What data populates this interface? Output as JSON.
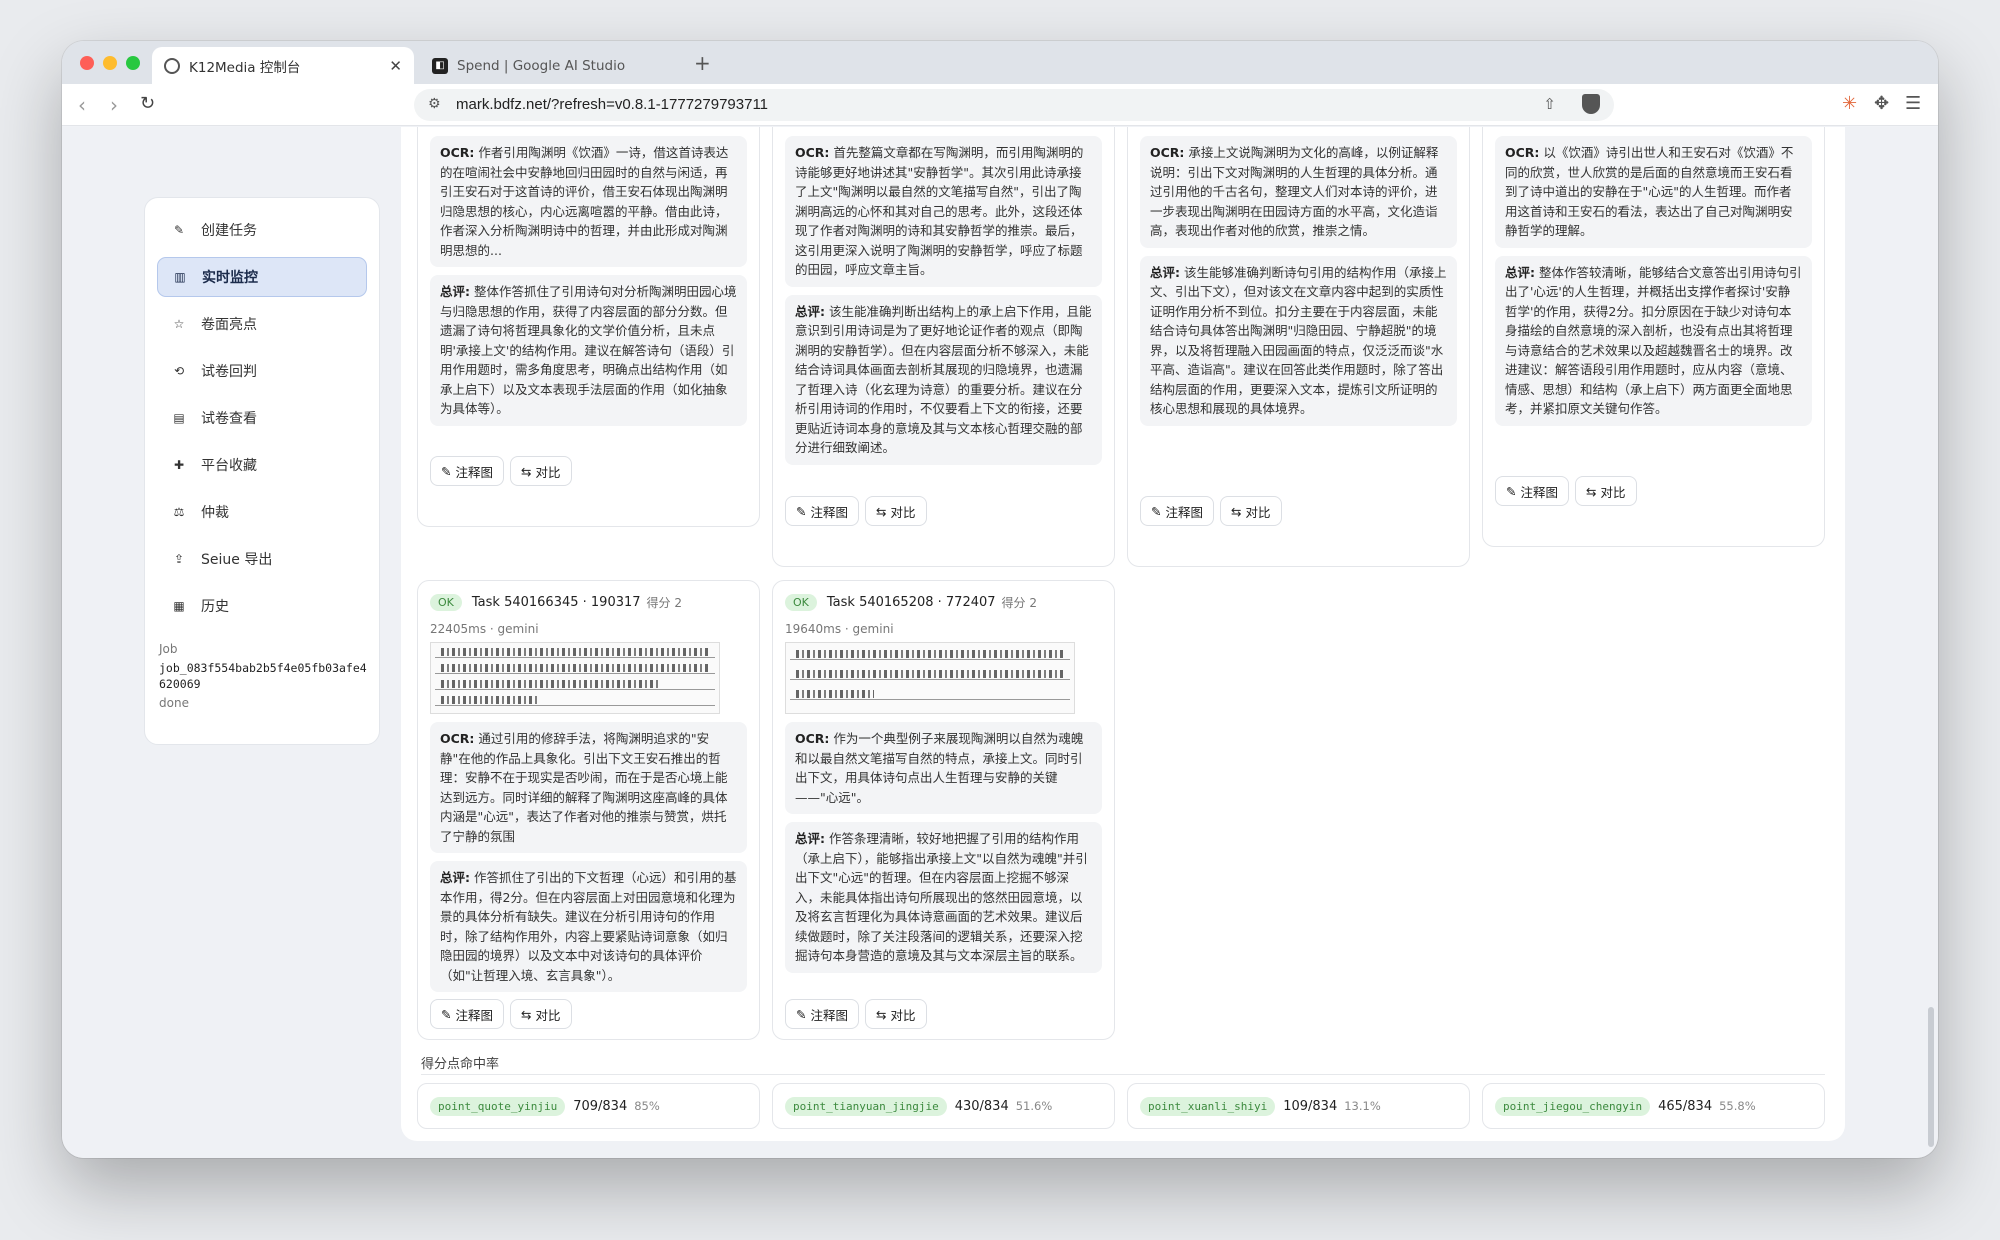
{
  "browser": {
    "tabs": [
      {
        "title": "K12Media 控制台",
        "close": "✕"
      },
      {
        "title": "Spend | Google AI Studio"
      }
    ],
    "new_tab": "+",
    "url": "mark.bdfz.net/?refresh=v0.8.1-1777279793711",
    "nav": {
      "back": "‹",
      "forward": "›",
      "reload": "↻"
    }
  },
  "sidebar": {
    "items": [
      {
        "label": "创建任务",
        "icon": "✎"
      },
      {
        "label": "实时监控",
        "icon": "▥",
        "active": true
      },
      {
        "label": "卷面亮点",
        "icon": "☆"
      },
      {
        "label": "试卷回判",
        "icon": "⟲"
      },
      {
        "label": "试卷查看",
        "icon": "▤"
      },
      {
        "label": "平台收藏",
        "icon": "✚"
      },
      {
        "label": "仲裁",
        "icon": "⚖"
      },
      {
        "label": "Seiue 导出",
        "icon": "⇪"
      },
      {
        "label": "历史",
        "icon": "▦"
      }
    ],
    "job": {
      "label": "Job",
      "id": "job_083f554bab2b5f4e05fb03afe4620069",
      "status": "done"
    }
  },
  "buttons": {
    "annotate": "注释图",
    "compare": "对比"
  },
  "cards_top": [
    {
      "ocr_label": "OCR:",
      "ocr": "作者引用陶渊明《饮酒》一诗，借这首诗表达的在喧闹社会中安静地回归田园时的自然与闲适，再引王安石对于这首诗的评价，借王安石体现出陶渊明归隐思想的核心，内心远离喧嚣的平静。借由此诗，作者深入分析陶渊明诗中的哲理，并由此形成对陶渊明思想的...",
      "comment_label": "总评:",
      "comment": "整体作答抓住了引用诗句对分析陶渊明田园心境与归隐思想的作用，获得了内容层面的部分分数。但遗漏了诗句将哲理具象化的文学价值分析，且未点明'承接上文'的结构作用。建议在解答诗句（语段）引用作用题时，需多角度思考，明确点出结构作用（如承上启下）以及文本表现手法层面的作用（如化抽象为具体等）。"
    },
    {
      "ocr_label": "OCR:",
      "ocr": "首先整篇文章都在写陶渊明，而引用陶渊明的诗能够更好地讲述其\"安静哲学\"。其次引用此诗承接了上文\"陶渊明以最自然的文笔描写自然\"，引出了陶渊明高远的心怀和其对自己的思考。此外，这段还体现了作者对陶渊明的诗和其安静哲学的推崇。最后，这引用更深入说明了陶渊明的安静哲学，呼应了标题的田园，呼应文章主旨。",
      "comment_label": "总评:",
      "comment": "该生能准确判断出结构上的承上启下作用，且能意识到引用诗词是为了更好地论证作者的观点（即陶渊明的安静哲学）。但在内容层面分析不够深入，未能结合诗词具体画面去剖析其展现的归隐境界，也遗漏了哲理入诗（化玄理为诗意）的重要分析。建议在分析引用诗词的作用时，不仅要看上下文的衔接，还要更贴近诗词本身的意境及其与文本核心哲理交融的部分进行细致阐述。"
    },
    {
      "ocr_label": "OCR:",
      "ocr": "承接上文说陶渊明为文化的高峰，以例证解释说明：引出下文对陶渊明的人生哲理的具体分析。通过引用他的千古名句，整理文人们对本诗的评价，进一步表现出陶渊明在田园诗方面的水平高，文化造诣高，表现出作者对他的欣赏，推崇之情。",
      "comment_label": "总评:",
      "comment": "该生能够准确判断诗句引用的结构作用（承接上文、引出下文），但对该文在文章内容中起到的实质性证明作用分析不到位。扣分主要在于内容层面，未能结合诗句具体答出陶渊明\"归隐田园、宁静超脱\"的境界，以及将哲理融入田园画面的特点，仅泛泛而谈\"水平高、造诣高\"。建议在回答此类作用题时，除了答出结构层面的作用，更要深入文本，提炼引文所证明的核心思想和展现的具体境界。"
    },
    {
      "ocr_label": "OCR:",
      "ocr": "以《饮酒》诗引出世人和王安石对《饮酒》不同的欣赏，世人欣赏的是后面的自然意境而王安石看到了诗中道出的安静在于\"心远\"的人生哲理。而作者用这首诗和王安石的看法，表达出了自己对陶渊明安静哲学的理解。",
      "comment_label": "总评:",
      "comment": "整体作答较清晰，能够结合文意答出引用诗句引出了'心远'的人生哲理，并概括出支撑作者探讨'安静哲学'的作用，获得2分。扣分原因在于缺少对诗句本身描绘的自然意境的深入剖析，也没有点出其将哲理与诗意结合的艺术效果以及超越魏晋名士的境界。改进建议：解答语段引用作用题时，应从内容（意境、情感、思想）和结构（承上启下）两方面更全面地思考，并紧扣原文关键句作答。"
    }
  ],
  "cards_bottom": [
    {
      "status": "OK",
      "task": "Task 540166345 · 190317",
      "score": "得分 2",
      "meta": "22405ms · gemini",
      "ocr_label": "OCR:",
      "ocr": "通过引用的修辞手法，将陶渊明追求的\"安静\"在他的作品上具象化。引出下文王安石推出的哲理：安静不在于现实是否吵闹，而在于是否心境上能达到远方。同时详细的解释了陶渊明这座高峰的具体内涵是\"心远\"，表达了作者对他的推崇与赞赏，烘托了宁静的氛围",
      "comment_label": "总评:",
      "comment": "作答抓住了引出的下文哲理（心远）和引用的基本作用，得2分。但在内容层面上对田园意境和化理为景的具体分析有缺失。建议在分析引用诗句的作用时，除了结构作用外，内容上要紧贴诗词意象（如归隐田园的境界）以及文本中对该诗句的具体评价（如\"让哲理入境、玄言具象\"）。"
    },
    {
      "status": "OK",
      "task": "Task 540165208 · 772407",
      "score": "得分 2",
      "meta": "19640ms · gemini",
      "ocr_label": "OCR:",
      "ocr": "作为一个典型例子来展现陶渊明以自然为魂魄和以最自然文笔描写自然的特点，承接上文。同时引出下文，用具体诗句点出人生哲理与安静的关键——\"心远\"。",
      "comment_label": "总评:",
      "comment": "作答条理清晰，较好地把握了引用的结构作用（承上启下），能够指出承接上文\"以自然为魂魄\"并引出下文\"心远\"的哲理。但在内容层面上挖掘不够深入，未能具体指出诗句所展现出的悠然田园意境，以及将玄言哲理化为具体诗意画面的艺术效果。建议后续做题时，除了关注段落间的逻辑关系，还要深入挖掘诗句本身营造的意境及其与文本深层主旨的联系。"
    }
  ],
  "hit_rate": {
    "title": "得分点命中率",
    "items": [
      {
        "tag": "point_quote_yinjiu",
        "count": "709/834",
        "pct": "85%"
      },
      {
        "tag": "point_tianyuan_jingjie",
        "count": "430/834",
        "pct": "51.6%"
      },
      {
        "tag": "point_xuanli_shiyi",
        "count": "109/834",
        "pct": "13.1%"
      },
      {
        "tag": "point_jiegou_chengyin",
        "count": "465/834",
        "pct": "55.8%"
      }
    ]
  }
}
